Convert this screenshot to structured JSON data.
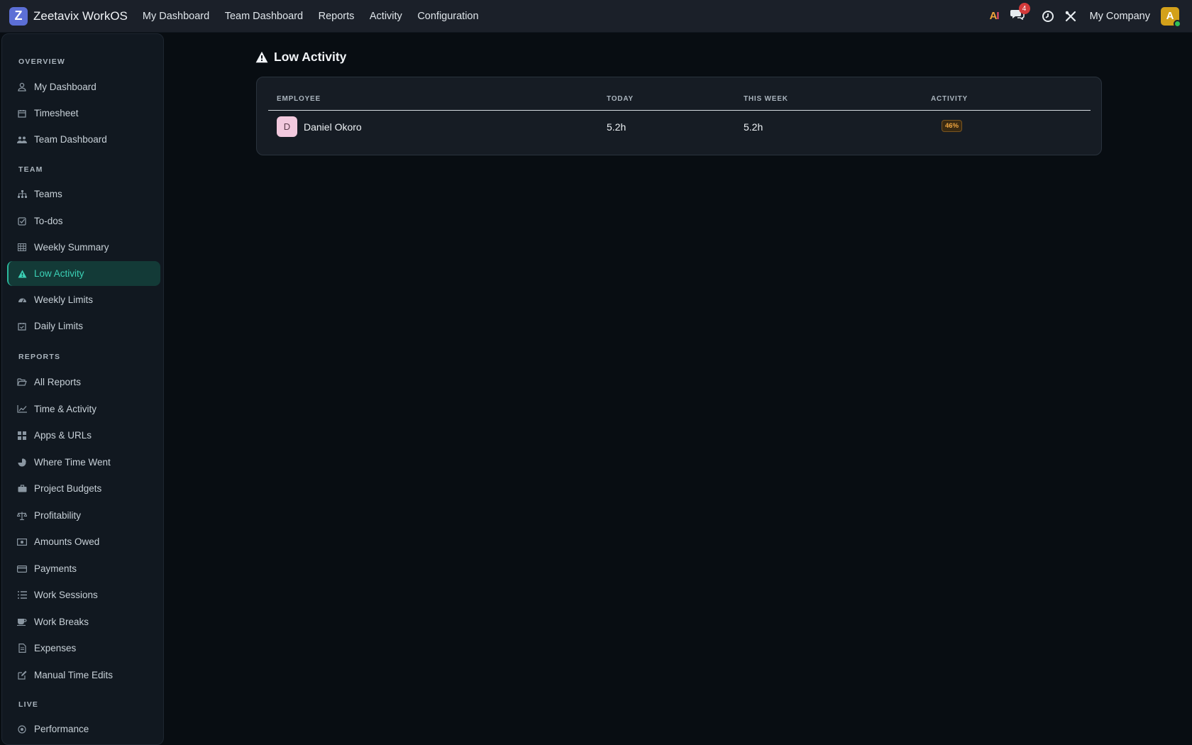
{
  "app": {
    "logo_letter": "Z",
    "name": "Zeetavix WorkOS"
  },
  "topnav": {
    "items": [
      {
        "label": "My Dashboard"
      },
      {
        "label": "Team Dashboard"
      },
      {
        "label": "Reports"
      },
      {
        "label": "Activity"
      },
      {
        "label": "Configuration"
      }
    ]
  },
  "topright": {
    "ai_label": "AI",
    "chat_badge": "4",
    "company": "My Company",
    "avatar_letter": "A",
    "icons": [
      "ai-icon",
      "chat-icon",
      "clock-icon",
      "tools-icon"
    ]
  },
  "sidebar": {
    "sections": [
      {
        "label": "OVERVIEW",
        "items": [
          {
            "label": "My Dashboard",
            "icon": "user-icon"
          },
          {
            "label": "Timesheet",
            "icon": "calendar-icon"
          },
          {
            "label": "Team Dashboard",
            "icon": "users-icon"
          }
        ]
      },
      {
        "label": "TEAM",
        "items": [
          {
            "label": "Teams",
            "icon": "sitemap-icon"
          },
          {
            "label": "To-dos",
            "icon": "checkbox-icon"
          },
          {
            "label": "Weekly Summary",
            "icon": "table-icon"
          },
          {
            "label": "Low Activity",
            "icon": "warning-icon",
            "active": true
          },
          {
            "label": "Weekly Limits",
            "icon": "gauge-icon"
          },
          {
            "label": "Daily Limits",
            "icon": "calendar-check-icon"
          }
        ]
      },
      {
        "label": "REPORTS",
        "items": [
          {
            "label": "All Reports",
            "icon": "folder-open-icon"
          },
          {
            "label": "Time & Activity",
            "icon": "line-chart-icon"
          },
          {
            "label": "Apps & URLs",
            "icon": "grid-icon"
          },
          {
            "label": "Where Time Went",
            "icon": "pie-chart-icon"
          },
          {
            "label": "Project Budgets",
            "icon": "briefcase-icon"
          },
          {
            "label": "Profitability",
            "icon": "scale-icon"
          },
          {
            "label": "Amounts Owed",
            "icon": "money-icon"
          },
          {
            "label": "Payments",
            "icon": "credit-card-icon"
          },
          {
            "label": "Work Sessions",
            "icon": "list-icon"
          },
          {
            "label": "Work Breaks",
            "icon": "coffee-icon"
          },
          {
            "label": "Expenses",
            "icon": "file-icon"
          },
          {
            "label": "Manual Time Edits",
            "icon": "edit-icon"
          }
        ]
      },
      {
        "label": "LIVE",
        "items": [
          {
            "label": "Performance",
            "icon": "target-icon"
          }
        ]
      }
    ]
  },
  "page": {
    "title": "Low Activity",
    "table": {
      "headers": [
        "EMPLOYEE",
        "TODAY",
        "THIS WEEK",
        "ACTIVITY"
      ],
      "rows": [
        {
          "initial": "D",
          "employee": "Daniel Okoro",
          "today": "5.2h",
          "week": "5.2h",
          "activity": "46%"
        }
      ]
    }
  },
  "colors": {
    "accent": "#3bd1b6",
    "active_bg": "#133a37",
    "warning": "#f0a640",
    "badge_red": "#d33a3a"
  }
}
